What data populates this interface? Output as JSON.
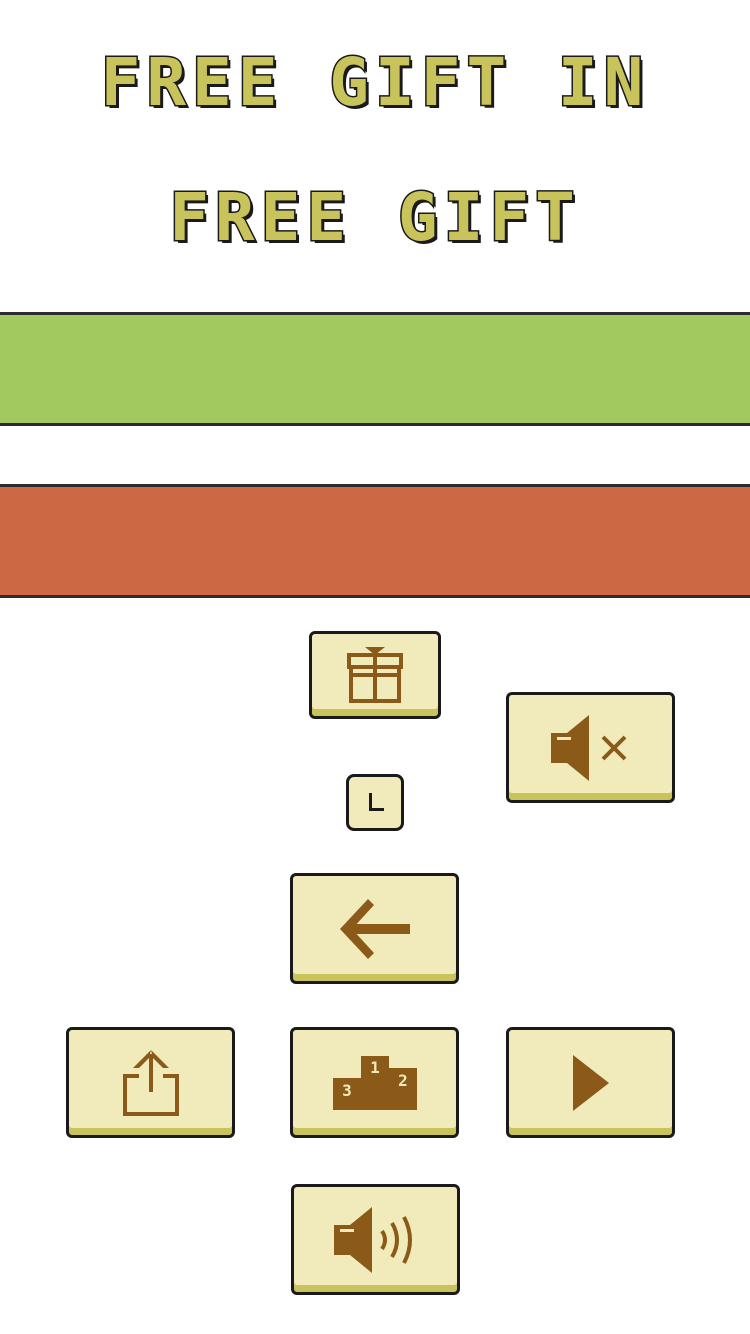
{
  "titles": {
    "line1": "FREE GIFT IN",
    "line2": "FREE GIFT"
  },
  "colors": {
    "background": "#ffffff",
    "title_fill": "#c8c35a",
    "title_outline": "#1a1a1a",
    "band_top": "#a2c95f",
    "band_bottom": "#cc6944",
    "button_face": "#f1ebbb",
    "button_shadow": "#c8c35a",
    "icon": "#8c5a18"
  },
  "buttons": {
    "gift": {
      "icon": "gift-icon"
    },
    "timer": {
      "icon": "clock-icon"
    },
    "mute": {
      "icon": "speaker-muted-icon"
    },
    "back": {
      "icon": "arrow-left-icon"
    },
    "share": {
      "icon": "share-icon"
    },
    "leaderboard": {
      "icon": "podium-icon",
      "places": [
        "1",
        "2",
        "3"
      ]
    },
    "play": {
      "icon": "play-icon"
    },
    "sound": {
      "icon": "speaker-on-icon"
    }
  }
}
